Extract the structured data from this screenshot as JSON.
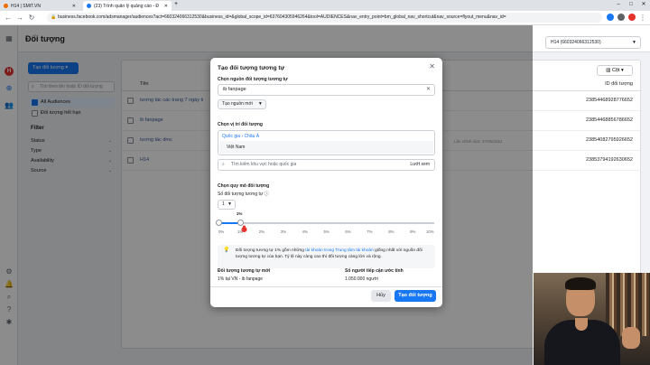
{
  "browser": {
    "tabs": [
      {
        "label": "H14 | SMIT.VN"
      },
      {
        "label": "(23) Trình quản lý quảng cáo - Đ"
      }
    ],
    "url": "business.facebook.com/adsmanager/audiences?act=660324066312530&business_id=&global_scope_id=637604305946264&tool=AUDIENCES&nav_entry_point=bm_global_nav_shortcut&nav_source=flyout_menu&nav_id="
  },
  "page": {
    "title": "Đối tượng",
    "account_selector": "H14 (660324066312530)"
  },
  "sidebar": {
    "create_button": "Tạo đối tượng",
    "search_placeholder": "Tìm theo tên hoặc ID đối tượng",
    "lists": [
      {
        "label": "All Audiences",
        "checked": true
      },
      {
        "label": "Đối tượng hết hạn",
        "checked": false
      }
    ],
    "filter_heading": "Filter",
    "filters": [
      "Status",
      "Type",
      "Availability",
      "Source"
    ]
  },
  "table": {
    "columns_button": "Cột",
    "name_header": "Tên",
    "id_header": "ID đối tượng",
    "rows": [
      {
        "name": "tương tác các trang 7 ngày từ 20-3",
        "id": "23854468928776652",
        "note": ""
      },
      {
        "name": "ib fanpage",
        "id": "23854468856786652",
        "note": ""
      },
      {
        "name": "tương tác dmc",
        "id": "23854082795926652",
        "note": "Lần chỉnh sửa: 27/05/2021"
      },
      {
        "name": "H14",
        "id": "23853794192630652",
        "note": ""
      }
    ]
  },
  "modal": {
    "title": "Tạo đối tượng tương tự",
    "source_label": "Chọn nguồn đối tượng tương tự",
    "source_value": "ib fanpage",
    "new_source_button": "Tạo nguồn mới",
    "location_label": "Chọn vị trí đối tượng",
    "location_group": "Quốc gia › Châu Á",
    "location_selected": "Việt Nam",
    "location_search_placeholder": "Tìm kiếm khu vực hoặc quốc gia",
    "browse_link": "Lướt xem",
    "size_heading": "Chọn quy mô đối tượng",
    "count_label": "Số đối tượng tương tự",
    "count_value": "1",
    "slider_flag": "1%",
    "slider_value_percent": 1,
    "slider_ticks": [
      "0%",
      "1%",
      "2%",
      "3%",
      "4%",
      "5%",
      "6%",
      "7%",
      "8%",
      "9%",
      "10%"
    ],
    "hint_pre": "Đối tượng tương tự 1% gồm những ",
    "hint_link": "tài khoản trong Trung tâm tài khoản",
    "hint_post": " giống nhất với nguồn đối tượng tương tự của bạn. Tỷ lệ này càng cao thì đối tượng càng lớn và rộng.",
    "new_audience_label": "Đối tượng tương tự mới",
    "new_audience_value": "1% tại VN - ib fanpage",
    "reach_label": "Số người tiếp cận ước tính",
    "reach_value": "1.050.000 người",
    "cancel_button": "Hủy",
    "create_button": "Tạo đối tượng"
  },
  "colors": {
    "accent": "#1877f2",
    "rail_avatar": "#e4322d"
  }
}
